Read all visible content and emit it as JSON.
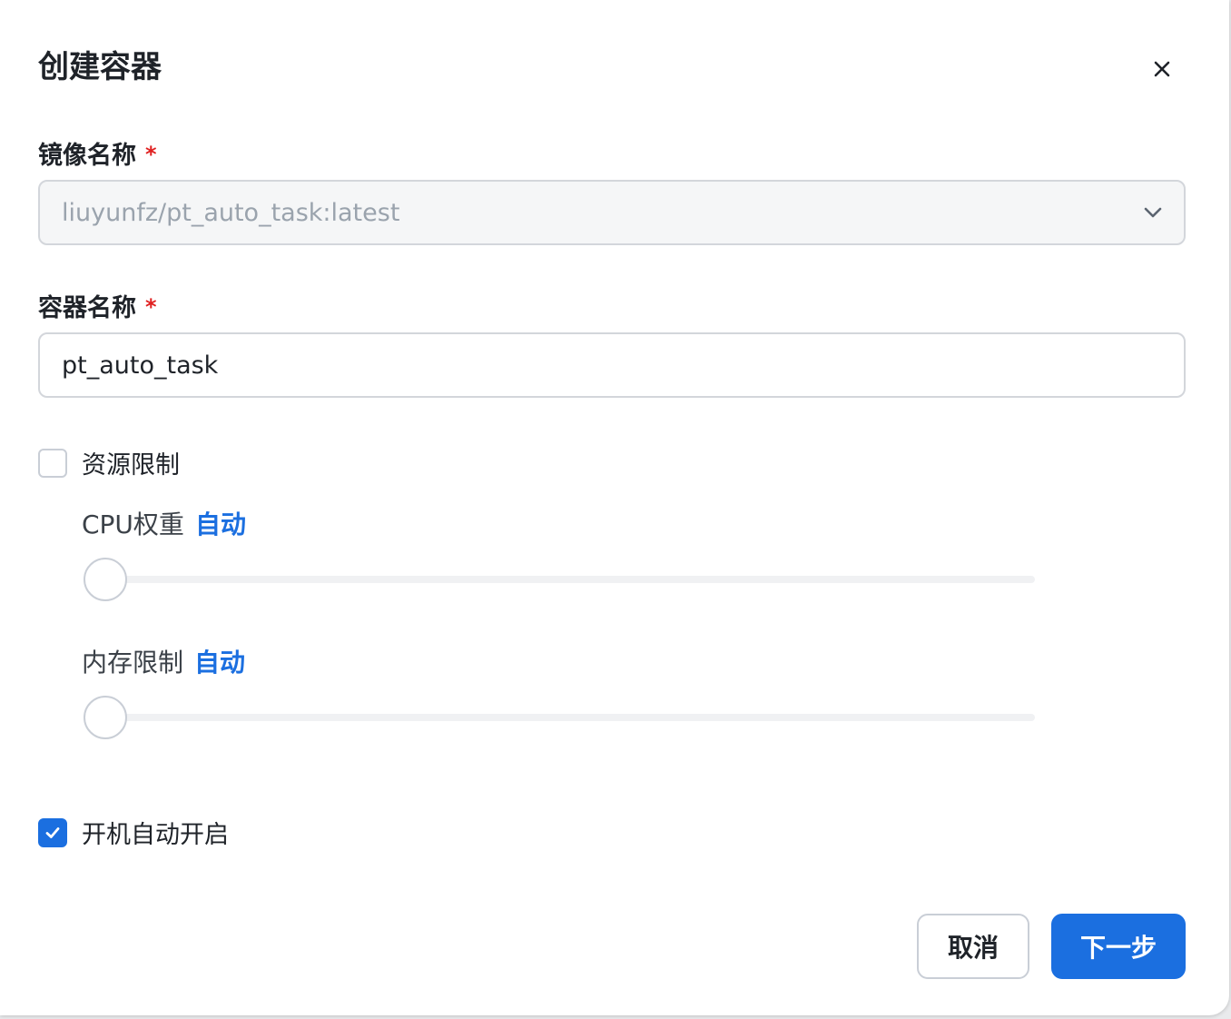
{
  "dialog": {
    "title": "创建容器",
    "close_icon": "close-icon"
  },
  "image_field": {
    "label": "镜像名称",
    "required_mark": "*",
    "value": "liuyunfz/pt_auto_task:latest",
    "icon": "chevron-down-icon",
    "disabled": true
  },
  "container_field": {
    "label": "容器名称",
    "required_mark": "*",
    "value": "pt_auto_task"
  },
  "resource_limit": {
    "label": "资源限制",
    "checked": false
  },
  "cpu": {
    "label": "CPU权重",
    "value_text": "自动",
    "slider_value": 0
  },
  "memory": {
    "label": "内存限制",
    "value_text": "自动",
    "slider_value": 0
  },
  "autostart": {
    "label": "开机自动开启",
    "checked": true
  },
  "footer": {
    "cancel_label": "取消",
    "next_label": "下一步"
  },
  "colors": {
    "primary": "#1b6fe0",
    "required": "#e02020"
  }
}
